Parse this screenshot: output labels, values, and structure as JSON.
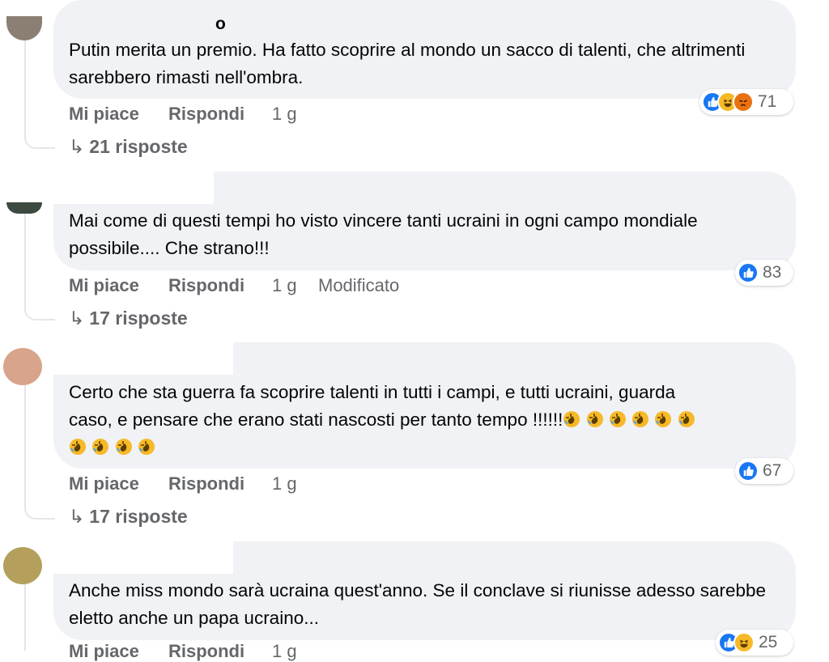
{
  "comments": [
    {
      "author": "o",
      "text": "Putin merita un premio. Ha fatto scoprire al mondo un sacco di talenti, che altrimenti sarebbero rimasti nell'ombra.",
      "like_label": "Mi piace",
      "reply_label": "Rispondi",
      "time": "1 g",
      "reactions": [
        "like",
        "haha",
        "angry"
      ],
      "reaction_count": "71",
      "replies_label": "21 risposte"
    },
    {
      "author": "",
      "text": "Mai come di questi tempi ho visto vincere tanti ucraini in ogni campo mondiale possibile.... Che strano!!!",
      "like_label": "Mi piace",
      "reply_label": "Rispondi",
      "time": "1 g",
      "edited_label": "Modificato",
      "reactions": [
        "like"
      ],
      "reaction_count": "83",
      "replies_label": "17 risposte"
    },
    {
      "author": "",
      "text_line1": "Certo che sta guerra fa scoprire talenti in tutti i campi, e tutti ucraini, guarda",
      "text_line2": "caso, e pensare che erano stati nascosti per tanto tempo !!!!!!",
      "emoji_name": "rolling-on-floor-laughing",
      "emoji_count_line2": 6,
      "emoji_count_line3": 4,
      "like_label": "Mi piace",
      "reply_label": "Rispondi",
      "time": "1 g",
      "reactions": [
        "like"
      ],
      "reaction_count": "67",
      "replies_label": "17 risposte"
    },
    {
      "author": "",
      "text": "Anche miss mondo sarà ucraina quest'anno. Se il conclave si riunisse adesso sarebbe eletto anche un papa ucraino...",
      "like_label": "Mi piace",
      "reply_label": "Rispondi",
      "time": "1 g",
      "reactions": [
        "like",
        "haha"
      ],
      "reaction_count": "25"
    }
  ],
  "colors": {
    "bubble": "#f0f2f5",
    "secondary_text": "#65676b",
    "like_blue": "#1877f2",
    "haha_yellow": "#f7b928",
    "angry_orange": "#e9710f"
  }
}
